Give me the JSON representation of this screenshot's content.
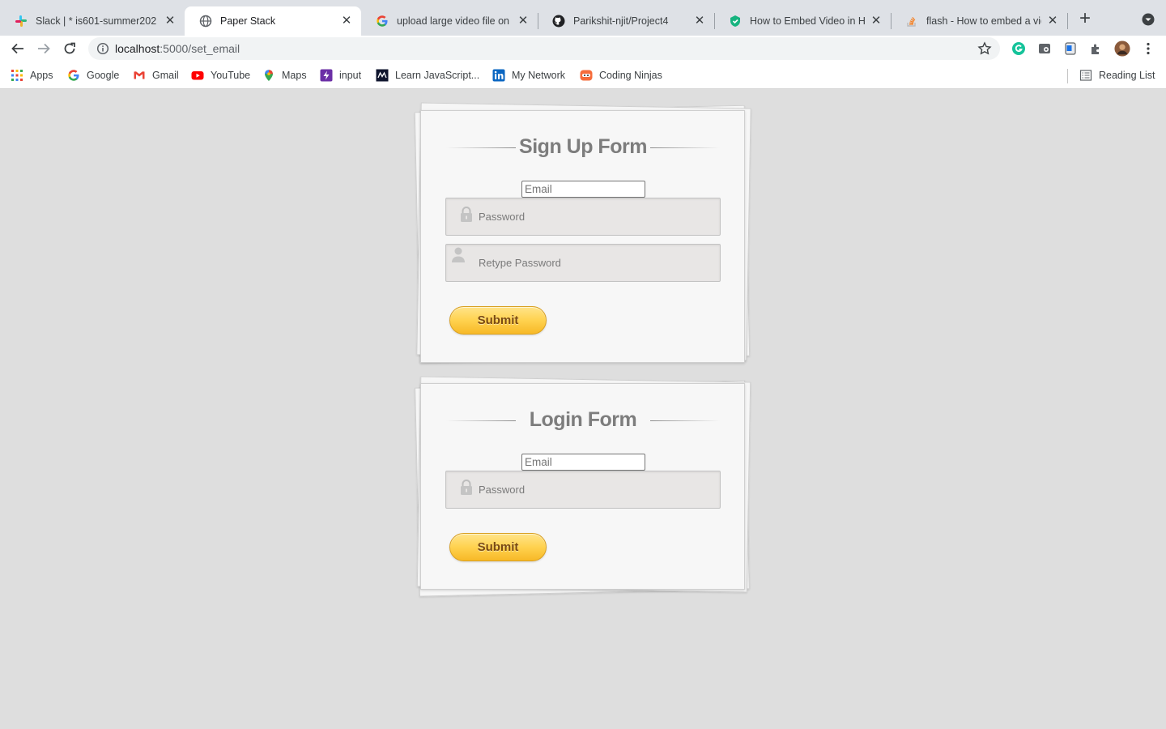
{
  "browser": {
    "tabs": [
      {
        "title": "Slack | * is601-summer202",
        "icon": "slack-icon",
        "active": false
      },
      {
        "title": "Paper Stack",
        "icon": "globe-icon",
        "active": true
      },
      {
        "title": "upload large video file on g",
        "icon": "google-icon",
        "active": false
      },
      {
        "title": "Parikshit-njit/Project4",
        "icon": "github-icon",
        "active": false
      },
      {
        "title": "How to Embed Video in HTI",
        "icon": "shield-icon",
        "active": false
      },
      {
        "title": "flash - How to embed a vid",
        "icon": "stackoverflow-icon",
        "active": false
      }
    ],
    "new_tab_label": "+",
    "url_host": "localhost",
    "url_path": ":5000/set_email",
    "bookmarks": [
      {
        "label": "Apps",
        "icon": "apps-grid-icon"
      },
      {
        "label": "Google",
        "icon": "google-icon"
      },
      {
        "label": "Gmail",
        "icon": "gmail-icon"
      },
      {
        "label": "YouTube",
        "icon": "youtube-icon"
      },
      {
        "label": "Maps",
        "icon": "maps-pin-icon"
      },
      {
        "label": "input",
        "icon": "bolt-icon"
      },
      {
        "label": "Learn JavaScript...",
        "icon": "codecademy-icon"
      },
      {
        "label": "My Network",
        "icon": "linkedin-icon"
      },
      {
        "label": "Coding Ninjas",
        "icon": "coding-ninjas-icon"
      }
    ],
    "reading_list": "Reading List"
  },
  "signup": {
    "title": "Sign Up Form",
    "email_placeholder": "Email",
    "password_placeholder": "Password",
    "retype_placeholder": "Retype Password",
    "submit": "Submit"
  },
  "login": {
    "title": "Login Form",
    "email_placeholder": "Email",
    "password_placeholder": "Password",
    "submit": "Submit"
  },
  "colors": {
    "page_bg": "#dedede",
    "card_bg": "#f7f7f7",
    "heading": "#7d7d7d",
    "button_top": "#ffe48a",
    "button_bottom": "#f7b927",
    "button_text": "#7a4a12"
  }
}
